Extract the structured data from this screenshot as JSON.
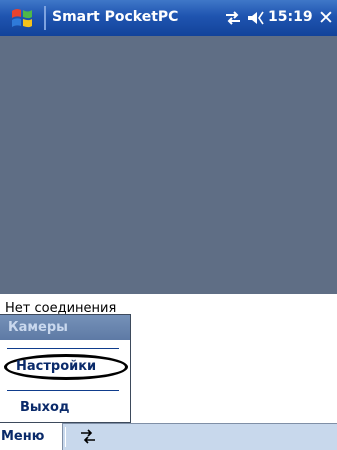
{
  "title_bar": {
    "app_title": "Smart PocketPC",
    "clock": "15:19",
    "close_label": "✕",
    "start_icon": "windows-flag-icon",
    "connectivity_icon": "connectivity-arrows-icon",
    "volume_icon": "speaker-icon"
  },
  "main": {
    "status_text": "Нет соединения"
  },
  "menu": {
    "items": [
      {
        "label": "Камеры"
      },
      {
        "label": "Настройки"
      },
      {
        "label": "Выход"
      }
    ]
  },
  "bottom_bar": {
    "menu_label": "Меню",
    "input_panel_icon": "connectivity-arrows-icon"
  },
  "colors": {
    "title_bar": "#1f54b0",
    "video_background": "#5f6e85",
    "menu_text": "#0a2a6a",
    "input_panel": "#c8d8ec"
  }
}
